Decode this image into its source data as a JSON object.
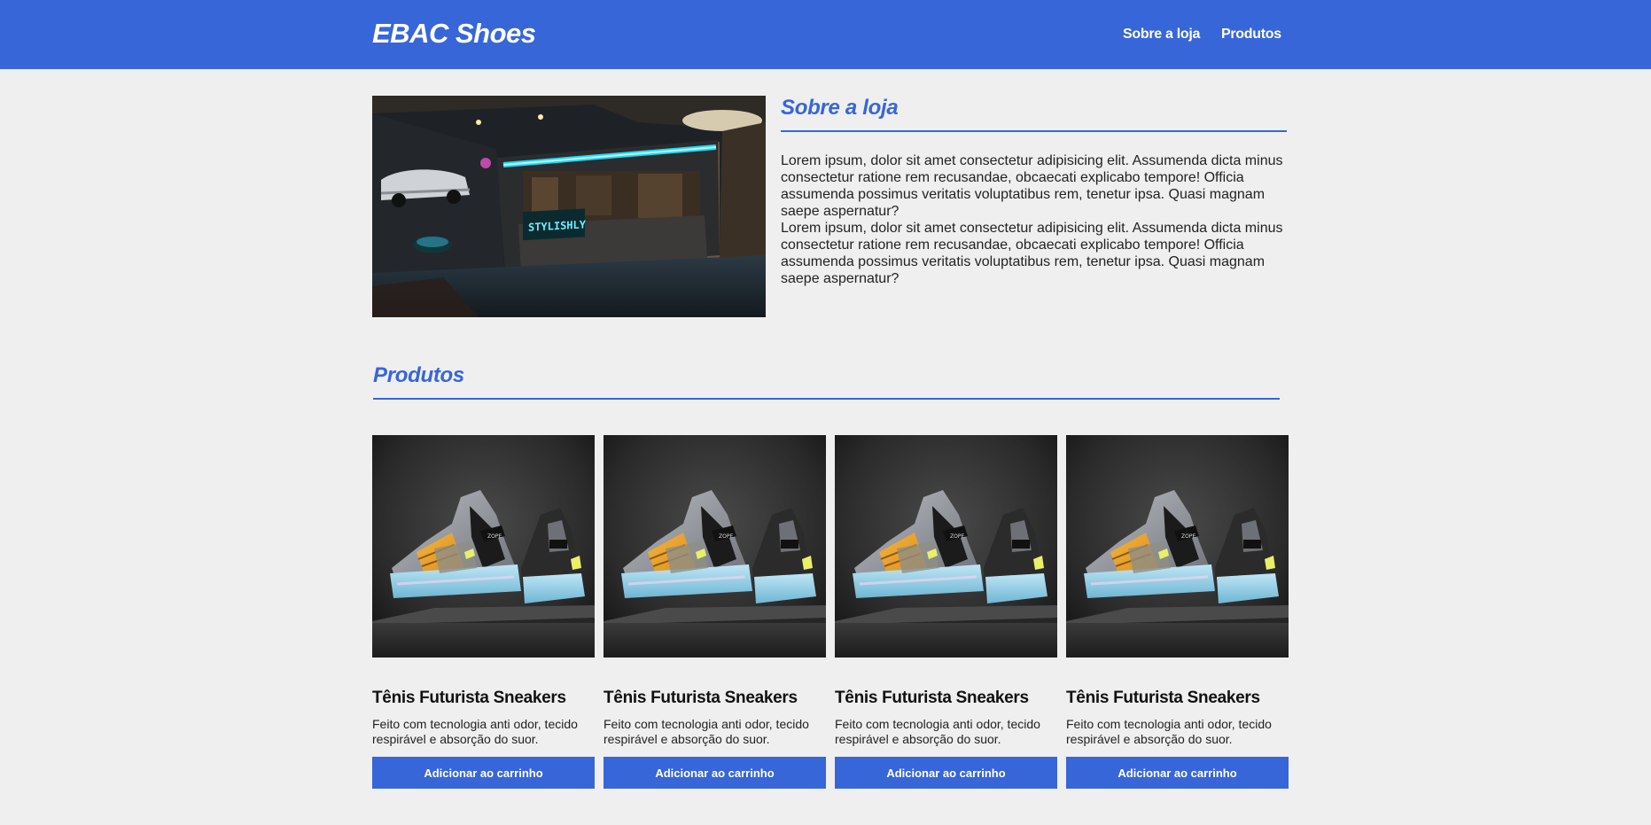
{
  "header": {
    "logo": "EBAC Shoes",
    "nav": [
      "Sobre a loja",
      "Produtos"
    ],
    "background_color": "#3766d8"
  },
  "about": {
    "title": "Sobre a loja",
    "image_alt": "store-front-neon-photo",
    "paragraphs": [
      "Lorem ipsum, dolor sit amet consectetur adipisicing elit. Assumenda dicta minus consectetur ratione rem recusandae, obcaecati explicabo tempore! Officia assumenda possimus veritatis voluptatibus rem, tenetur ipsa. Quasi magnam saepe aspernatur?",
      "Lorem ipsum, dolor sit amet consectetur adipisicing elit. Assumenda dicta minus consectetur ratione rem recusandae, obcaecati explicabo tempore! Officia assumenda possimus veritatis voluptatibus rem, tenetur ipsa. Quasi magnam saepe aspernatur?"
    ]
  },
  "products": {
    "title": "Produtos",
    "items": [
      {
        "name": "Tênis Futurista Sneakers",
        "description": "Feito com tecnologia anti odor, tecido respirável e absorção do suor.",
        "button": "Adicionar ao carrinho"
      },
      {
        "name": "Tênis Futurista Sneakers",
        "description": "Feito com tecnologia anti odor, tecido respirável e absorção do suor.",
        "button": "Adicionar ao carrinho"
      },
      {
        "name": "Tênis Futurista Sneakers",
        "description": "Feito com tecnologia anti odor, tecido respirável e absorção do suor.",
        "button": "Adicionar ao carrinho"
      },
      {
        "name": "Tênis Futurista Sneakers",
        "description": "Feito com tecnologia anti odor, tecido respirável e absorção do suor.",
        "button": "Adicionar ao carrinho"
      }
    ]
  },
  "colors": {
    "accent": "#3766d8",
    "page_background": "#efefef",
    "text": "#222222"
  }
}
